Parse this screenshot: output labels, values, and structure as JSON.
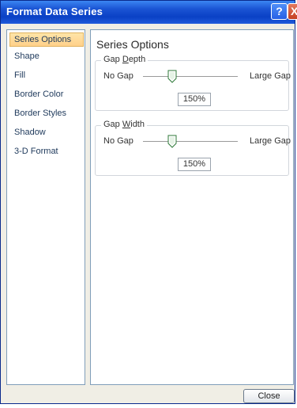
{
  "window": {
    "title": "Format Data Series",
    "help_label": "?",
    "close_glyph": "X"
  },
  "sidebar": {
    "items": [
      {
        "label": "Series Options",
        "selected": true
      },
      {
        "label": "Shape"
      },
      {
        "label": "Fill"
      },
      {
        "label": "Border Color"
      },
      {
        "label": "Border Styles"
      },
      {
        "label": "Shadow"
      },
      {
        "label": "3-D Format"
      }
    ]
  },
  "panel": {
    "title": "Series Options",
    "gap_depth": {
      "label_prefix": "Gap ",
      "label_mnemonic": "D",
      "label_suffix": "epth",
      "min_label": "No Gap",
      "max_label": "Large Gap",
      "value": "150%"
    },
    "gap_width": {
      "label_prefix": "Gap ",
      "label_mnemonic": "W",
      "label_suffix": "idth",
      "min_label": "No Gap",
      "max_label": "Large Gap",
      "value": "150%"
    }
  },
  "footer": {
    "close_label": "Close"
  },
  "colors": {
    "title_bar": "#0a41c5",
    "selected_item": "#ffd08a"
  }
}
